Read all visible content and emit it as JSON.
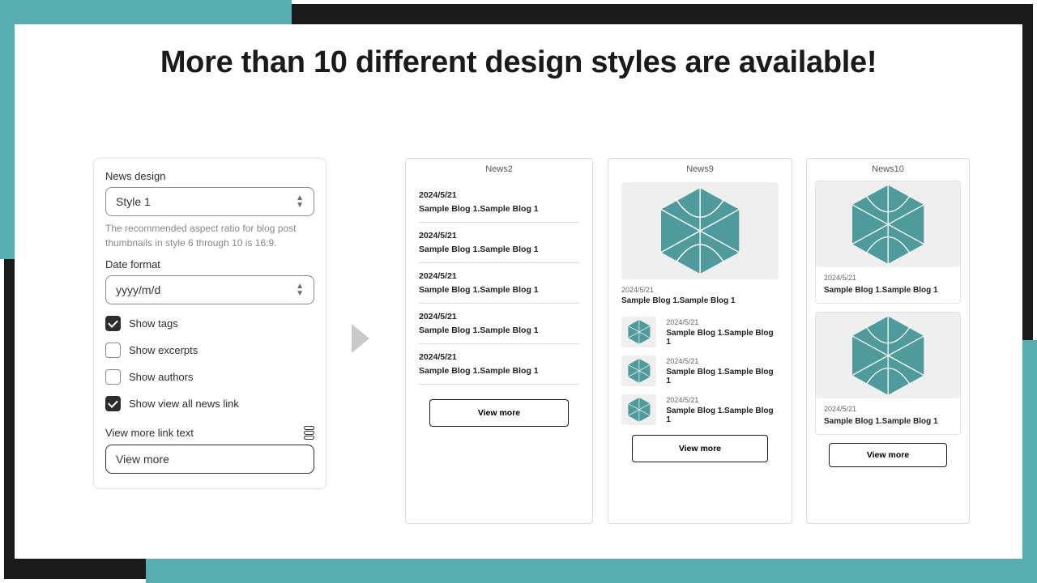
{
  "headline": "More than 10 different design styles are available!",
  "settings": {
    "news_design_label": "News design",
    "style_value": "Style 1",
    "help": "The recommended aspect ratio for blog post thumbnails in style 6 through 10 is 16:9.",
    "date_format_label": "Date format",
    "date_format_value": "yyyy/m/d",
    "show_tags": "Show tags",
    "show_excerpts": "Show excerpts",
    "show_authors": "Show authors",
    "show_view_all": "Show view all news link",
    "view_more_label": "View more link text",
    "view_more_value": "View more"
  },
  "sample": {
    "date": "2024/5/21",
    "title": "Sample Blog 1.Sample Blog 1",
    "view_more": "View more"
  },
  "previews": {
    "p2": "News2",
    "p9": "News9",
    "p10": "News10"
  },
  "colors": {
    "teal": "#4e9a9d"
  }
}
